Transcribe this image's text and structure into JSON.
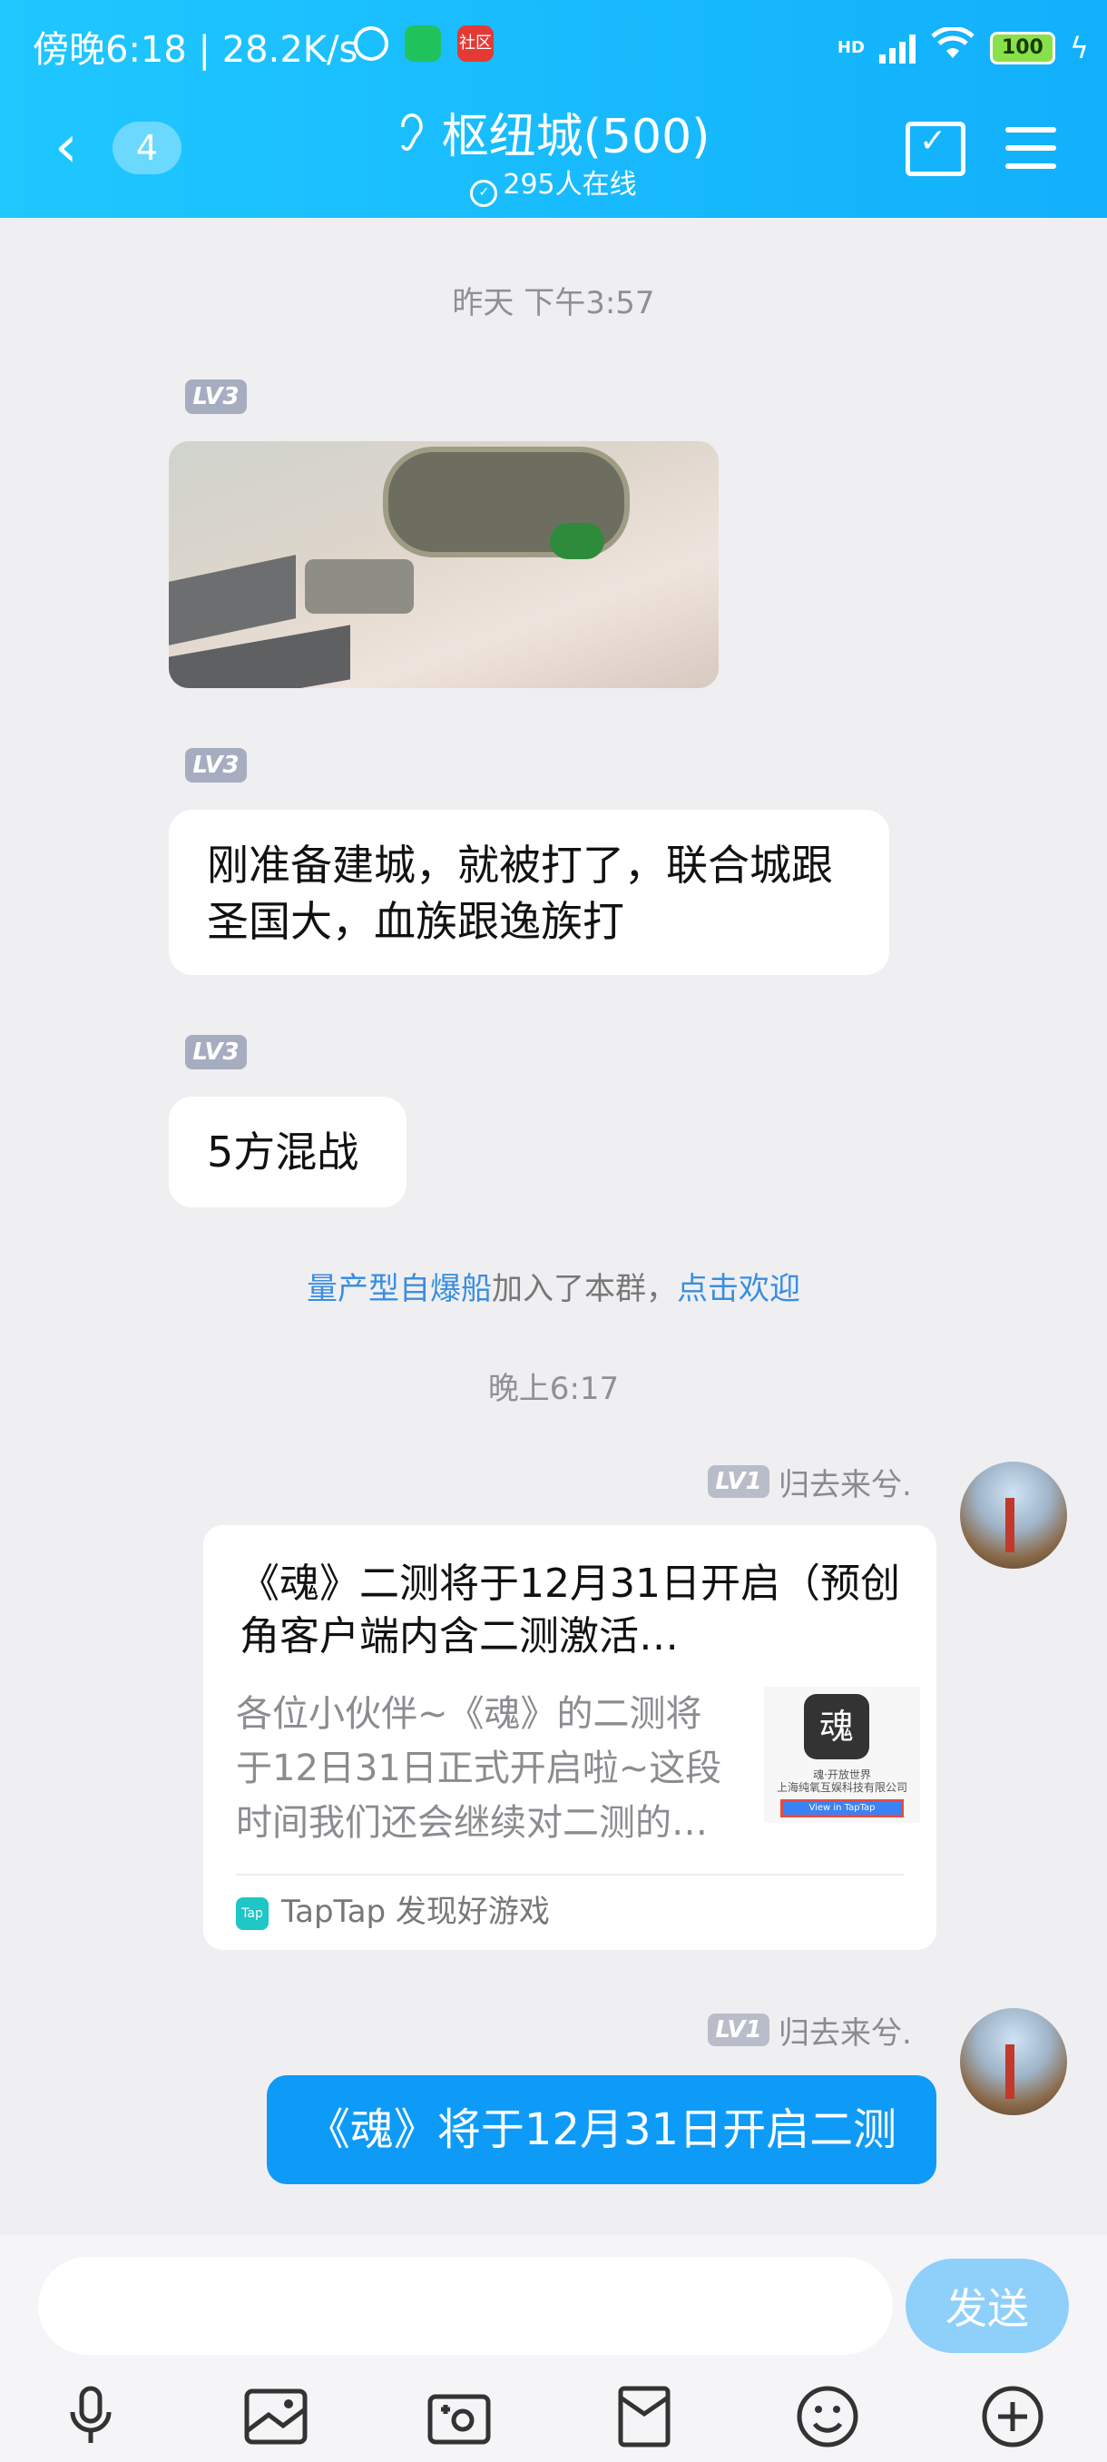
{
  "status_bar": {
    "time_speed": "傍晚6:18 | 28.2K/s",
    "shequ_badge": "社区",
    "hd": "HD",
    "battery": "100"
  },
  "header": {
    "back_count": "4",
    "title": "枢纽城(500)",
    "online": "295人在线"
  },
  "messages": {
    "time1": "昨天 下午3:57",
    "lv_badge": "LV3",
    "text1": "刚准备建城，就被打了，联合城跟圣国大，血族跟逸族打",
    "text2": "5方混战",
    "system_user": "量产型自爆船",
    "system_mid": "加入了本群，",
    "system_link": "点击欢迎",
    "time2": "晚上6:17",
    "sender_lv": "LV1",
    "sender_name": "归去来兮.",
    "card": {
      "title": "《魂》二测将于12月31日开启（预创角客户端内含二测激活…",
      "desc": "各位小伙伴~《魂》的二测将于12日31日正式开启啦~这段时间我们还会继续对二测的…",
      "thumb_logo": "魂",
      "thumb_line1": "魂·开放世界",
      "thumb_line2": "上海纯氧互娱科技有限公司",
      "thumb_btn": "View in TapTap",
      "source_icon": "Tap",
      "source": "TapTap 发现好游戏"
    },
    "text3": "《魂》将于12月31日开启二测"
  },
  "input": {
    "placeholder": "",
    "send_label": "发送"
  },
  "toolbar": [
    "mic-icon",
    "picture-icon",
    "camera-icon",
    "red-packet-icon",
    "emoji-icon",
    "plus-icon"
  ]
}
